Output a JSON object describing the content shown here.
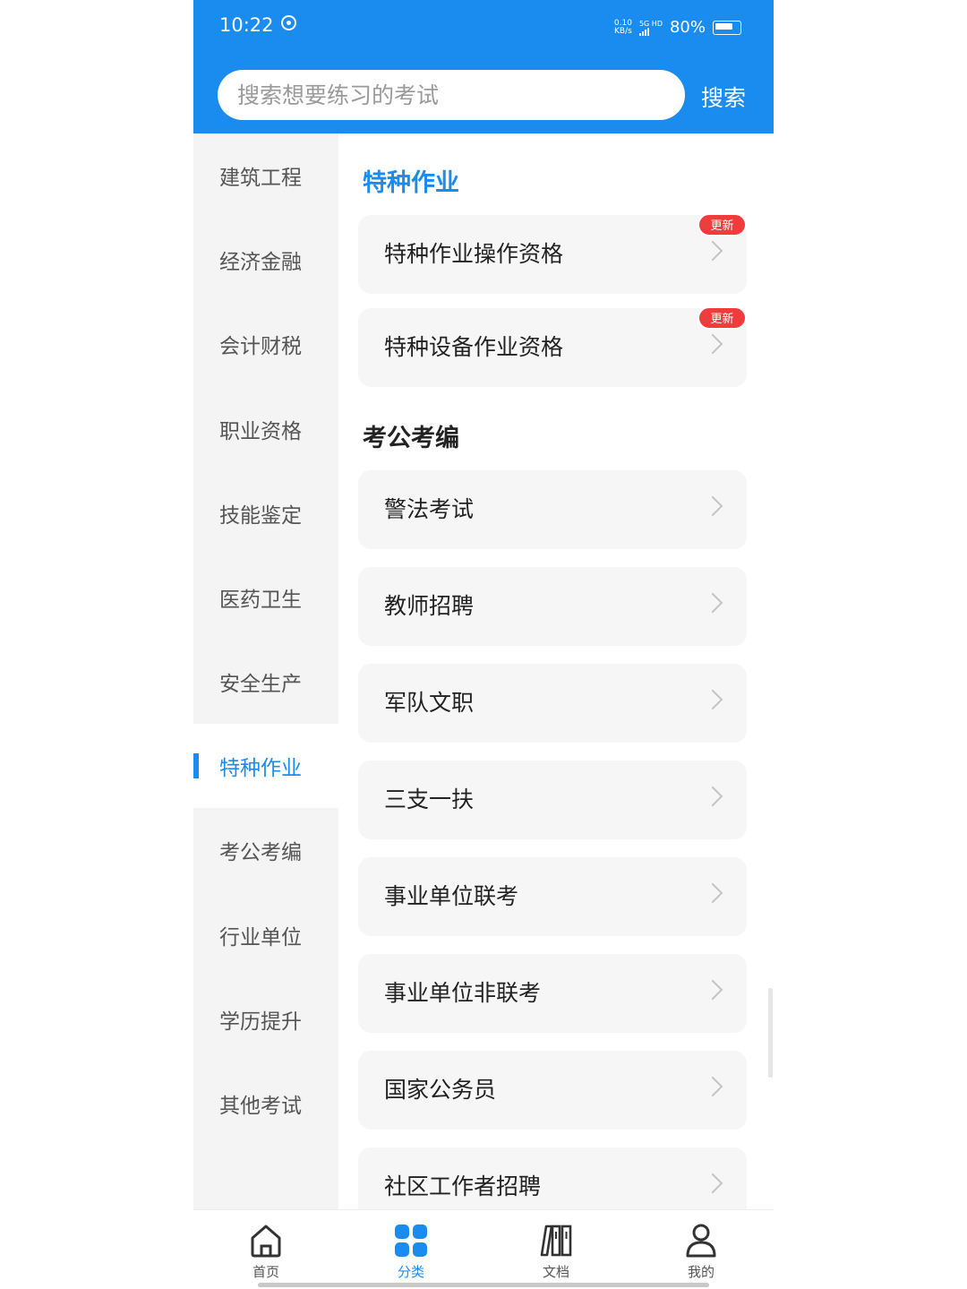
{
  "status_bar": {
    "time": "10:22",
    "net_speed_value": "0.10",
    "net_speed_unit": "KB/s",
    "network_type": "5G HD",
    "battery": "80%"
  },
  "search": {
    "placeholder": "搜索想要练习的考试",
    "button_label": "搜索"
  },
  "sidebar": {
    "items": [
      {
        "label": "建筑工程"
      },
      {
        "label": "经济金融"
      },
      {
        "label": "会计财税"
      },
      {
        "label": "职业资格"
      },
      {
        "label": "技能鉴定"
      },
      {
        "label": "医药卫生"
      },
      {
        "label": "安全生产"
      },
      {
        "label": "特种作业",
        "active": true
      },
      {
        "label": "考公考编"
      },
      {
        "label": "行业单位"
      },
      {
        "label": "学历提升"
      },
      {
        "label": "其他考试"
      }
    ]
  },
  "content": {
    "sections": [
      {
        "title": "特种作业",
        "items": [
          {
            "label": "特种作业操作资格",
            "badge": "更新"
          },
          {
            "label": "特种设备作业资格",
            "badge": "更新"
          }
        ]
      },
      {
        "title": "考公考编",
        "items": [
          {
            "label": "警法考试"
          },
          {
            "label": "教师招聘"
          },
          {
            "label": "军队文职"
          },
          {
            "label": "三支一扶"
          },
          {
            "label": "事业单位联考"
          },
          {
            "label": "事业单位非联考"
          },
          {
            "label": "国家公务员"
          },
          {
            "label": "社区工作者招聘"
          }
        ]
      }
    ]
  },
  "tabbar": {
    "tabs": [
      {
        "label": "首页",
        "icon": "home-icon"
      },
      {
        "label": "分类",
        "icon": "category-grid-icon",
        "active": true
      },
      {
        "label": "文档",
        "icon": "documents-icon"
      },
      {
        "label": "我的",
        "icon": "profile-icon"
      }
    ]
  },
  "colors": {
    "accent": "#1a8cf0",
    "badge": "#f03c3c",
    "sidebar_bg": "#f4f4f4",
    "card_bg": "#f6f6f6"
  }
}
